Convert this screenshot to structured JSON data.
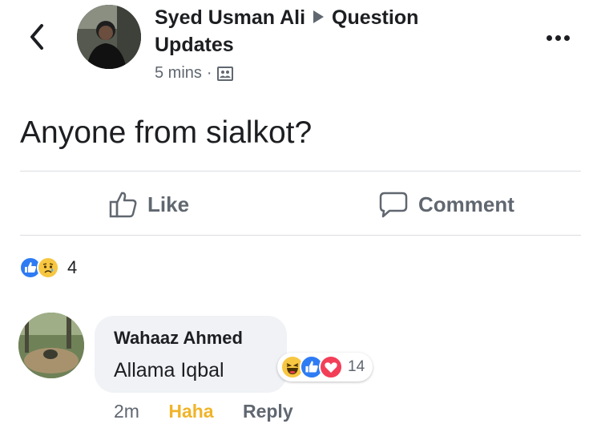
{
  "post": {
    "author": "Syed Usman Ali",
    "group": "Question",
    "group_line2": "Updates",
    "time": "5 mins",
    "separator": "·",
    "privacy_icon": "group-icon",
    "text": "Anyone from sialkot?"
  },
  "actions": {
    "like_label": "Like",
    "comment_label": "Comment"
  },
  "reactions": {
    "types": [
      "like",
      "sad"
    ],
    "count": "4"
  },
  "comment": {
    "author": "Wahaaz Ahmed",
    "text": "Allama Iqbal",
    "reaction_types": [
      "haha",
      "like",
      "love"
    ],
    "reaction_count": "14",
    "time": "2m",
    "my_reaction_label": "Haha",
    "reply_label": "Reply"
  },
  "colors": {
    "text": "#1c1e21",
    "secondary": "#606770",
    "like_blue": "#2e7bf4",
    "love_red": "#f33e58",
    "haha_yellow": "#f7c742",
    "haha_label": "#f0b429"
  }
}
